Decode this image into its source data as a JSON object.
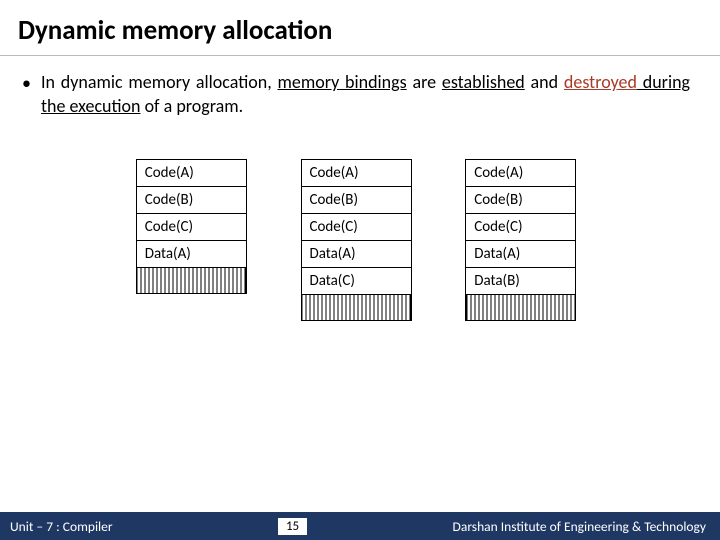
{
  "title": "Dynamic memory allocation",
  "bullet": {
    "lead": "In dynamic memory allocation, ",
    "u1": "memory bindings",
    "mid1": " are ",
    "u2": "established",
    "mid2": " and ",
    "u3_a": "destroyed",
    "u3_b": " during the execution",
    "tail": " of a program."
  },
  "tables": [
    {
      "rows": [
        {
          "label": "Code(A)",
          "hatch": false
        },
        {
          "label": "Code(B)",
          "hatch": false
        },
        {
          "label": "Code(C)",
          "hatch": false
        },
        {
          "label": "Data(A)",
          "hatch": false
        },
        {
          "label": "",
          "hatch": true
        }
      ]
    },
    {
      "rows": [
        {
          "label": "Code(A)",
          "hatch": false
        },
        {
          "label": "Code(B)",
          "hatch": false
        },
        {
          "label": "Code(C)",
          "hatch": false
        },
        {
          "label": "Data(A)",
          "hatch": false
        },
        {
          "label": "Data(C)",
          "hatch": false
        },
        {
          "label": "",
          "hatch": true
        }
      ]
    },
    {
      "rows": [
        {
          "label": "Code(A)",
          "hatch": false
        },
        {
          "label": "Code(B)",
          "hatch": false
        },
        {
          "label": "Code(C)",
          "hatch": false
        },
        {
          "label": "Data(A)",
          "hatch": false
        },
        {
          "label": "Data(B)",
          "hatch": false
        },
        {
          "label": "",
          "hatch": true
        }
      ]
    }
  ],
  "footer": {
    "unit": "Unit – 7  : Compiler",
    "page": "15",
    "org": "Darshan Institute of Engineering & Technology"
  }
}
